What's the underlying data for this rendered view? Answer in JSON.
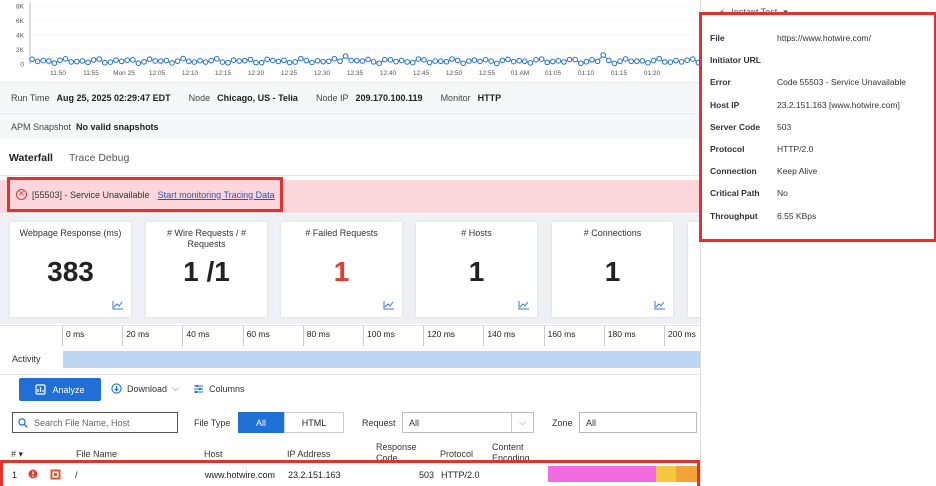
{
  "chart": {
    "y_ticks": [
      "8K",
      "6K",
      "4K",
      "2K",
      "0"
    ],
    "x_ticks": [
      "11:50",
      "11:55",
      "Mon 25",
      "12:05",
      "12:10",
      "12:15",
      "12:20",
      "12:25",
      "12:30",
      "12:35",
      "12:40",
      "12:45",
      "12:50",
      "12:55",
      "01 AM",
      "01:05",
      "01:10",
      "01:15",
      "01:20"
    ],
    "line_color": "#1f6fd6"
  },
  "run_info": {
    "run_time_label": "Run Time",
    "run_time_value": "Aug 25, 2025 02:29:47 EDT",
    "node_label": "Node",
    "node_value": "Chicago, US - Telia",
    "node_ip_label": "Node IP",
    "node_ip_value": "209.170.100.119",
    "monitor_label": "Monitor",
    "monitor_value": "HTTP"
  },
  "apm": {
    "label": "APM Snapshot",
    "value": "No valid snapshots"
  },
  "tabs": [
    "Waterfall",
    "Trace Debug"
  ],
  "error_banner": {
    "text": "[55503] - Service Unavailable",
    "link": "Start monitoring Tracing Data",
    "bg_color": "#fbd6da"
  },
  "cards": [
    {
      "title": "Webpage Response (ms)",
      "value": "383"
    },
    {
      "title": "# Wire Requests / # Requests",
      "value": "1 /1"
    },
    {
      "title": "# Failed Requests",
      "value": "1"
    },
    {
      "title": "# Hosts",
      "value": "1"
    },
    {
      "title": "# Connections",
      "value": "1"
    }
  ],
  "timeline": {
    "ticks": [
      "0 ms",
      "20 ms",
      "40 ms",
      "60 ms",
      "80 ms",
      "100 ms",
      "120 ms",
      "140 ms",
      "160 ms",
      "180 ms",
      "200 ms"
    ],
    "label": "Activity"
  },
  "toolbar": {
    "analyze": "Analyze",
    "download": "Download",
    "columns": "Columns"
  },
  "filter": {
    "search_placeholder": "Search File Name, Host",
    "file_type_label": "File Type",
    "file_type_options": [
      "All",
      "HTML"
    ],
    "request_label": "Request",
    "request_value": "All",
    "zone_label": "Zone",
    "zone_value": "All"
  },
  "table": {
    "headers": {
      "num": "# ▾",
      "file_name": "File Name",
      "host": "Host",
      "ip": "IP Address",
      "response_code": "Response Code",
      "protocol": "Protocol",
      "content_encoding": "Content Encoding"
    },
    "rows": [
      {
        "num": "1",
        "file": "/",
        "host": "www.hotwire.com",
        "ip": "23.2.151.163",
        "code": "503",
        "protocol": "HTTP/2.0"
      }
    ]
  },
  "side_panel": {
    "instant_test": "Instant Test",
    "details": [
      {
        "key": "File",
        "value": "https://www.hotwire.com/"
      },
      {
        "key": "Initiator URL",
        "value": ""
      },
      {
        "key": "Error",
        "value": "Code 55503 - Service Unavailable"
      },
      {
        "key": "Host IP",
        "value": "23.2.151.163 [www.hotwire.com]"
      },
      {
        "key": "Server Code",
        "value": "503"
      },
      {
        "key": "Protocol",
        "value": "HTTP/2.0"
      },
      {
        "key": "Connection",
        "value": "Keep Alive"
      },
      {
        "key": "Critical Path",
        "value": "No"
      },
      {
        "key": "Throughput",
        "value": "6.55 KBps"
      }
    ]
  }
}
